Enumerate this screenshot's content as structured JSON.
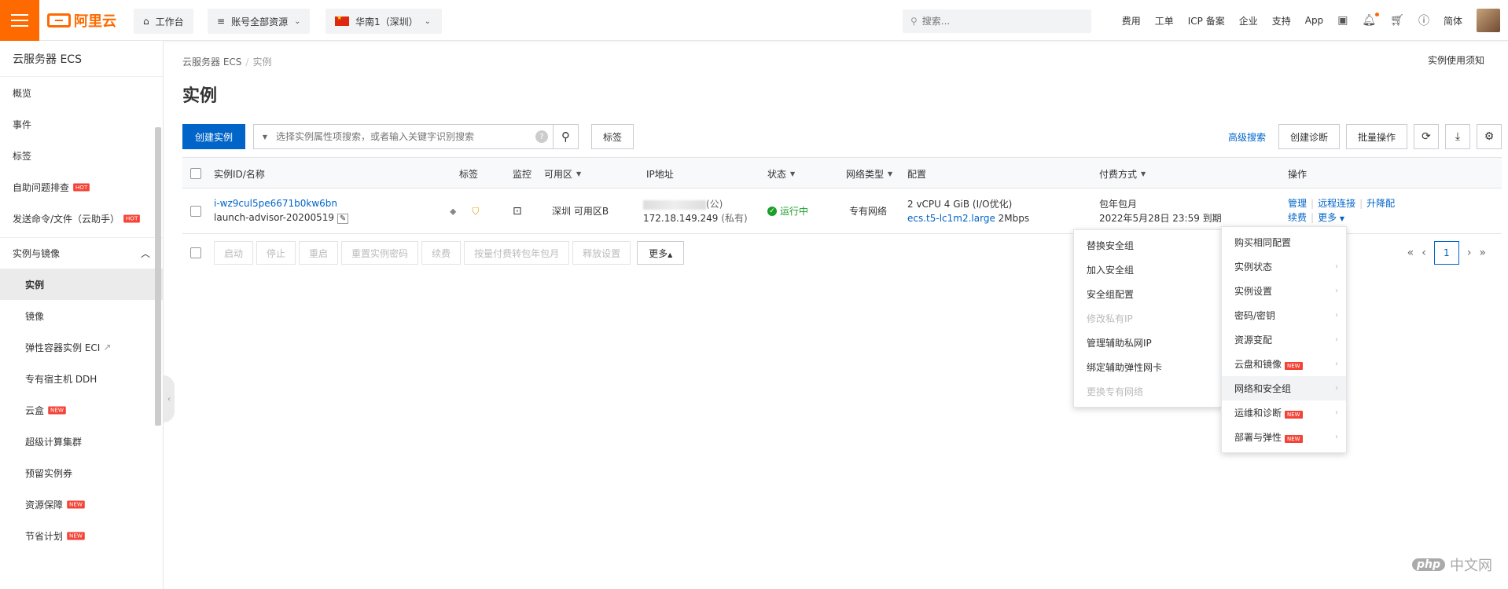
{
  "header": {
    "logo_text": "阿里云",
    "workbench": "工作台",
    "account_scope": "账号全部资源",
    "region": "华南1（深圳）",
    "search_placeholder": "搜索...",
    "links": [
      "费用",
      "工单",
      "ICP 备案",
      "企业",
      "支持",
      "App"
    ],
    "lang": "简体"
  },
  "sidebar": {
    "title": "云服务器 ECS",
    "items_top": [
      {
        "label": "概览"
      },
      {
        "label": "事件"
      },
      {
        "label": "标签"
      },
      {
        "label": "自助问题排查",
        "badge": "HOT"
      },
      {
        "label": "发送命令/文件（云助手）",
        "badge": "HOT"
      }
    ],
    "group": "实例与镜像",
    "sub_items": [
      {
        "label": "实例",
        "active": true
      },
      {
        "label": "镜像"
      },
      {
        "label": "弹性容器实例 ECI"
      },
      {
        "label": "专有宿主机 DDH"
      },
      {
        "label": "云盒",
        "badge": "NEW"
      },
      {
        "label": "超级计算集群"
      },
      {
        "label": "预留实例券"
      },
      {
        "label": "资源保障",
        "badge": "NEW"
      },
      {
        "label": "节省计划",
        "badge": "NEW"
      }
    ]
  },
  "main": {
    "breadcrumb": [
      "云服务器 ECS",
      "实例"
    ],
    "notice": "实例使用须知",
    "title": "实例",
    "create_button": "创建实例",
    "search_placeholder": "选择实例属性项搜索，或者输入关键字识别搜索",
    "tag_button": "标签",
    "advanced_search": "高级搜索",
    "create_diagnosis": "创建诊断",
    "batch_ops": "批量操作"
  },
  "table": {
    "columns": [
      "实例ID/名称",
      "标签",
      "监控",
      "可用区",
      "IP地址",
      "状态",
      "网络类型",
      "配置",
      "付费方式",
      "操作"
    ],
    "rows": [
      {
        "id": "i-wz9cul5pe6671b0kw6bn",
        "name": "launch-advisor-20200519",
        "zone": "深圳 可用区B",
        "ip_public_suffix": "(公)",
        "ip_private": "172.18.149.249",
        "ip_private_suffix": "(私有)",
        "status": "运行中",
        "network": "专有网络",
        "config_line1": "2 vCPU 4 GiB (I/O优化)",
        "config_spec": "ecs.t5-lc1m2.large",
        "config_bw": "2Mbps",
        "pay_type": "包年包月",
        "expire": "2022年5月28日 23:59 到期",
        "ops": [
          "管理",
          "远程连接",
          "升降配"
        ],
        "ops2": [
          "续费",
          "更多"
        ]
      }
    ],
    "bulk_buttons": [
      "启动",
      "停止",
      "重启",
      "重置实例密码",
      "续费",
      "按量付费转包年包月",
      "释放设置"
    ],
    "more_button": "更多",
    "page": "1"
  },
  "menu_right": [
    {
      "label": "购买相同配置",
      "arrow": false
    },
    {
      "label": "实例状态",
      "arrow": true
    },
    {
      "label": "实例设置",
      "arrow": true
    },
    {
      "label": "密码/密钥",
      "arrow": true
    },
    {
      "label": "资源变配",
      "arrow": true
    },
    {
      "label": "云盘和镜像",
      "arrow": true,
      "badge": "NEW"
    },
    {
      "label": "网络和安全组",
      "arrow": true,
      "highlight": true
    },
    {
      "label": "运维和诊断",
      "arrow": true,
      "badge": "NEW"
    },
    {
      "label": "部署与弹性",
      "arrow": true,
      "badge": "NEW"
    }
  ],
  "menu_left": [
    {
      "label": "替换安全组"
    },
    {
      "label": "加入安全组"
    },
    {
      "label": "安全组配置"
    },
    {
      "label": "修改私有IP",
      "disabled": true
    },
    {
      "label": "管理辅助私网IP"
    },
    {
      "label": "绑定辅助弹性网卡"
    },
    {
      "label": "更换专有网络",
      "disabled": true
    }
  ],
  "watermark": {
    "logo": "php",
    "text": "中文网"
  }
}
